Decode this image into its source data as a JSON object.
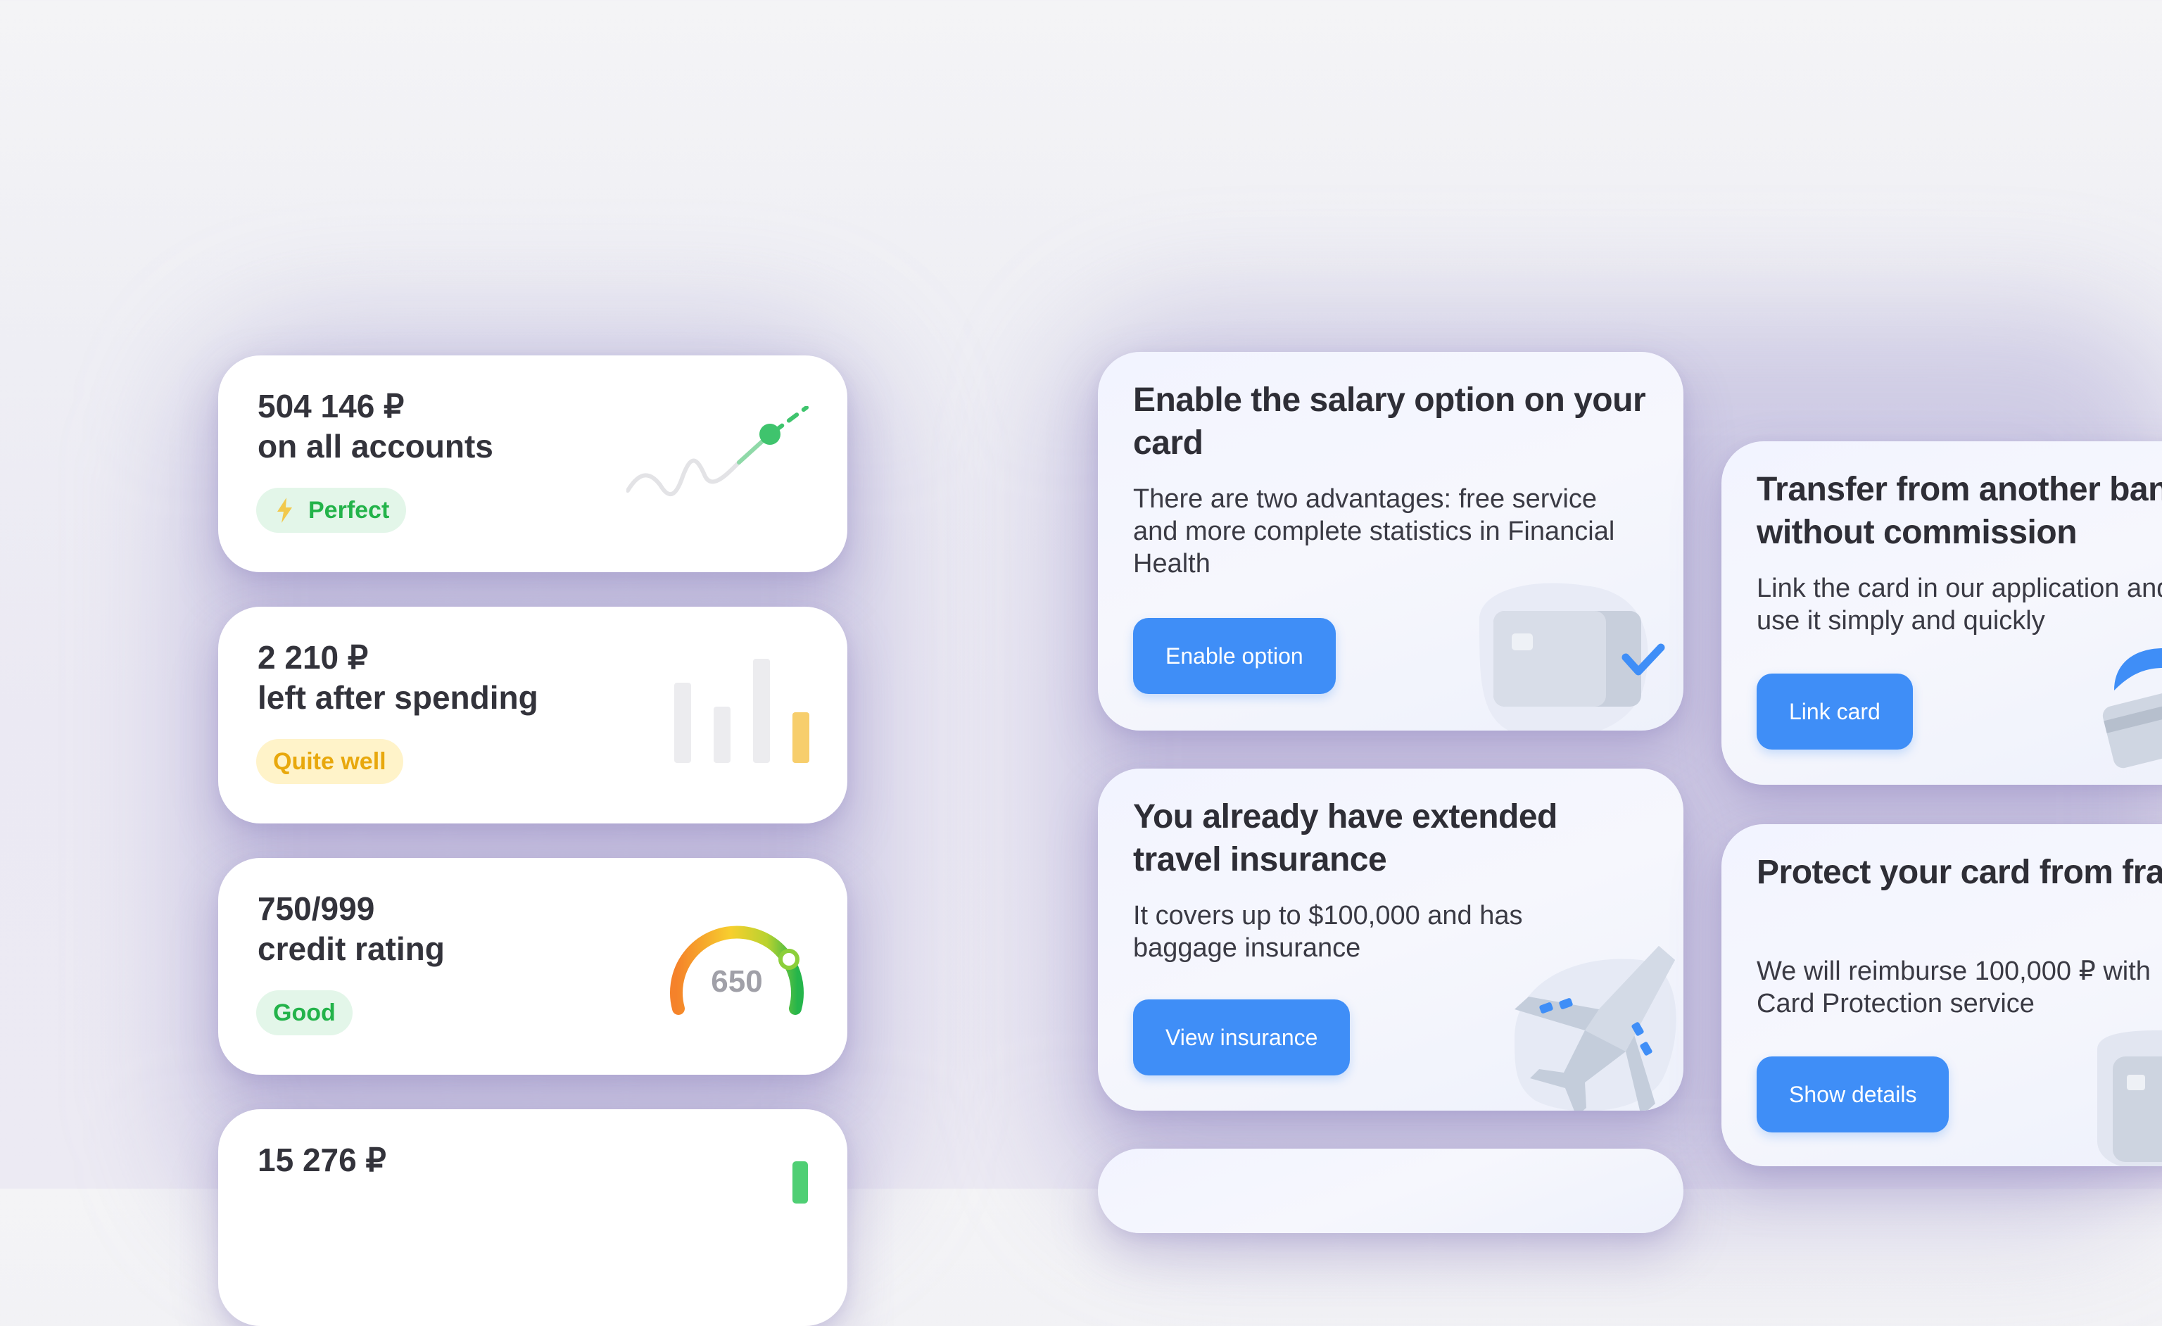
{
  "stats": [
    {
      "amount": "504 146 ₽",
      "caption": "on all accounts",
      "badge": "Perfect",
      "badge_color": "#23b34a"
    },
    {
      "amount": "2 210 ₽",
      "caption": "left after spending",
      "badge": "Quite well",
      "badge_color": "#e8a80d",
      "bars": [
        0.6,
        0.42,
        0.78,
        0.38
      ]
    },
    {
      "amount": "750/999",
      "caption": "credit rating",
      "badge": "Good",
      "gauge_value": "650"
    },
    {
      "amount": "15 276 ₽",
      "caption": ""
    }
  ],
  "promos": [
    {
      "title": "Enable the salary option on your card",
      "desc": "There are two advantages: free service and more complete statistics in Financial Health",
      "button": "Enable option"
    },
    {
      "title": "You already have extended travel insurance",
      "desc": "It covers up to $100,000 and has baggage insurance",
      "button": "View insurance"
    },
    {
      "title": "Transfer from another bank card without commission",
      "desc": "Link the card in our application and use it simply and quickly",
      "button": "Link card"
    },
    {
      "title": "Protect your card from fraud and losses",
      "desc": "We will reimburse 100,000 ₽ with Card Protection service",
      "button": "Show details"
    }
  ],
  "colors": {
    "accent": "#3f8ef7",
    "good": "#23b34a",
    "warning": "#e8a80d"
  }
}
